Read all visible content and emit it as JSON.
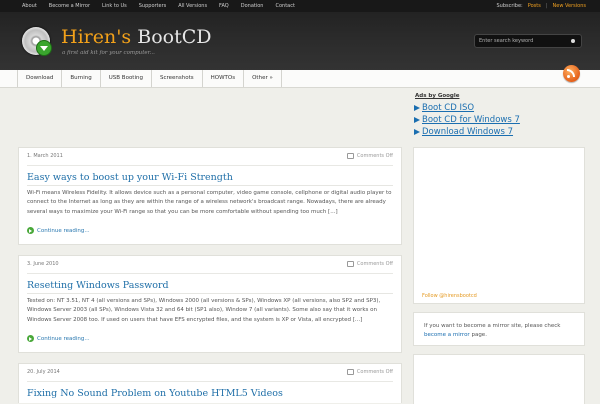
{
  "topnav": {
    "items": [
      "About",
      "Become a Mirror",
      "Link to Us",
      "Supporters",
      "All Versions",
      "FAQ",
      "Donation",
      "Contact"
    ],
    "subscribe_label": "Subscribe:",
    "subscribe_posts": "Posts",
    "subscribe_separator": "|",
    "subscribe_new_versions": "New Versions"
  },
  "header": {
    "title_part1": "Hiren's",
    "title_part2": "BootCD",
    "tagline": "a first aid kit for your computer...",
    "search_placeholder": "Enter search keyword"
  },
  "mainnav": {
    "items": [
      "Download",
      "Burning",
      "USB Booting",
      "Screenshots",
      "HOWTOs",
      "Other »"
    ]
  },
  "posts": [
    {
      "date": "1. March 2011",
      "comments": "Comments Off",
      "title": "Easy ways to boost up your Wi-Fi Strength",
      "excerpt": "Wi-Fi means Wireless Fidelity. It allows device such as a personal computer, video game console, cellphone or digital audio player to connect to the Internet as long as they are within the range of a wireless network's broadcast range. Nowadays, there are already several ways to maximize your Wi-Fi range so that you can be more comfortable without spending too much [...]",
      "readmore": "Continue reading..."
    },
    {
      "date": "3. June 2010",
      "comments": "Comments Off",
      "title": "Resetting Windows Password",
      "excerpt": "Tested on: NT 3.51, NT 4 (all versions and SPs), Windows 2000 (all versions & SPs), Windows XP (all versions, also SP2 and SP3), Windows Server 2003 (all SPs), Windows Vista 32 and 64 bit (SP1 also), Window 7 (all variants). Some also say that it works on Windows Server 2008 too. If used on users that have EFS encrypted files, and the system is XP or Vista, all encrypted [...]",
      "readmore": "Continue reading..."
    },
    {
      "date": "20. July 2014",
      "comments": "Comments Off",
      "title": "Fixing No Sound Problem on Youtube HTML5 Videos"
    }
  ],
  "sidebar": {
    "ads_title": "Ads by Google",
    "ad_links": [
      "Boot CD ISO",
      "Boot CD for Windows 7",
      "Download Windows 7"
    ],
    "follow": "Follow @hirensbootcd",
    "mirror_text_before": "If you want to become a mirror site, please check",
    "mirror_link": "become a mirror",
    "mirror_text_after": "page."
  }
}
